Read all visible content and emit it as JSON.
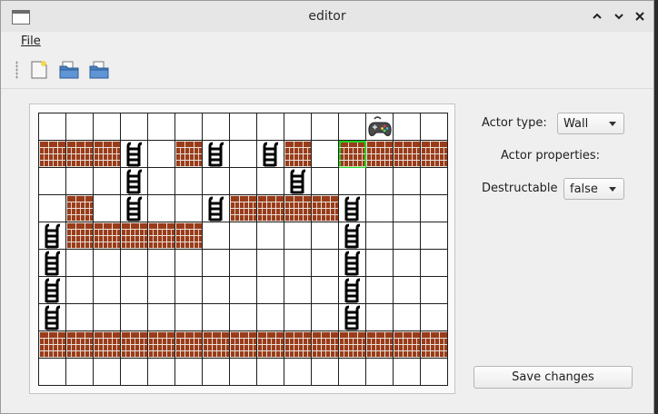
{
  "window": {
    "title": "editor"
  },
  "menu": {
    "file_label": "File"
  },
  "toolbar": {
    "icons": [
      "new-file-icon",
      "open-folder-icon",
      "save-folder-icon"
    ]
  },
  "editor": {
    "rows": 10,
    "cols": 15,
    "grid": [
      "............G..",
      "WWWL.WL.LW.WWWW",
      "...L.....L.....",
      ".W.L..LWWWWL...",
      "LWWWWW.....L...",
      "L..........L...",
      "L..........L...",
      "L..........L...",
      "WWWWWWWWWWWWWWW",
      "..............."
    ],
    "legend": {
      "W": "wall",
      "L": "ladder",
      "G": "player",
      ".": "empty"
    },
    "selected": {
      "row": 1,
      "col": 11
    }
  },
  "properties": {
    "actor_type_label": "Actor type:",
    "actor_type_value": "Wall",
    "actor_properties_label": "Actor properties:",
    "destructable_label": "Destructable",
    "destructable_value": "false",
    "save_label": "Save changes"
  },
  "colors": {
    "brick": "#9a3c1a",
    "mortar": "#e8e0d8",
    "selection": "#22d122"
  }
}
